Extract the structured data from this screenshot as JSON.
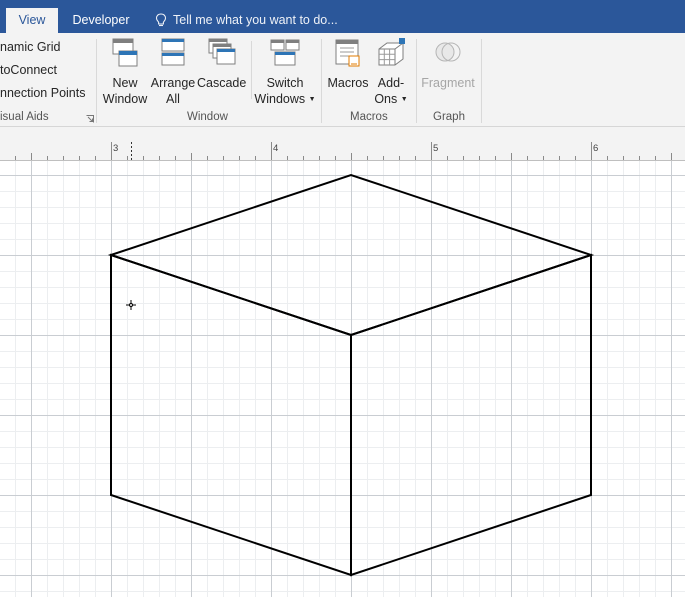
{
  "tabs": {
    "view": "View",
    "developer": "Developer"
  },
  "tell_me": {
    "placeholder": "Tell me what you want to do..."
  },
  "ribbon": {
    "visual_aids": {
      "items": [
        "namic Grid",
        "toConnect",
        "nnection Points"
      ],
      "group_label": "isual Aids"
    },
    "window": {
      "new_window": [
        "New",
        "Window"
      ],
      "arrange_all": [
        "Arrange",
        "All"
      ],
      "cascade": "Cascade",
      "switch_windows": [
        "Switch",
        "Windows"
      ],
      "group_label": "Window"
    },
    "macros": {
      "macros": "Macros",
      "add_ons": [
        "Add-",
        "Ons"
      ],
      "group_label": "Macros"
    },
    "graph": {
      "fragment": "Fragment",
      "group_label": "Graph"
    }
  },
  "ruler": {
    "labels": [
      "3",
      "4",
      "5",
      "6"
    ]
  },
  "colors": {
    "tab_bar": "#2b579a",
    "ribbon": "#f3f3f3",
    "accent_icon": "#2e75b6",
    "grid_major": "#c9cdd2",
    "grid_minor": "#eceef0",
    "shape_stroke": "#000000"
  },
  "icons": {
    "tell_me": "lightbulb-icon",
    "new_window": "new-window-icon",
    "arrange_all": "arrange-all-icon",
    "cascade": "cascade-icon",
    "switch_windows": "switch-windows-icon",
    "macros": "macros-icon",
    "add_ons": "add-ons-icon",
    "fragment": "fragment-icon",
    "dialog_launcher": "dialog-launcher-icon",
    "cursor": "crosshair-cursor-icon"
  },
  "drawing": {
    "shape": "cube"
  }
}
